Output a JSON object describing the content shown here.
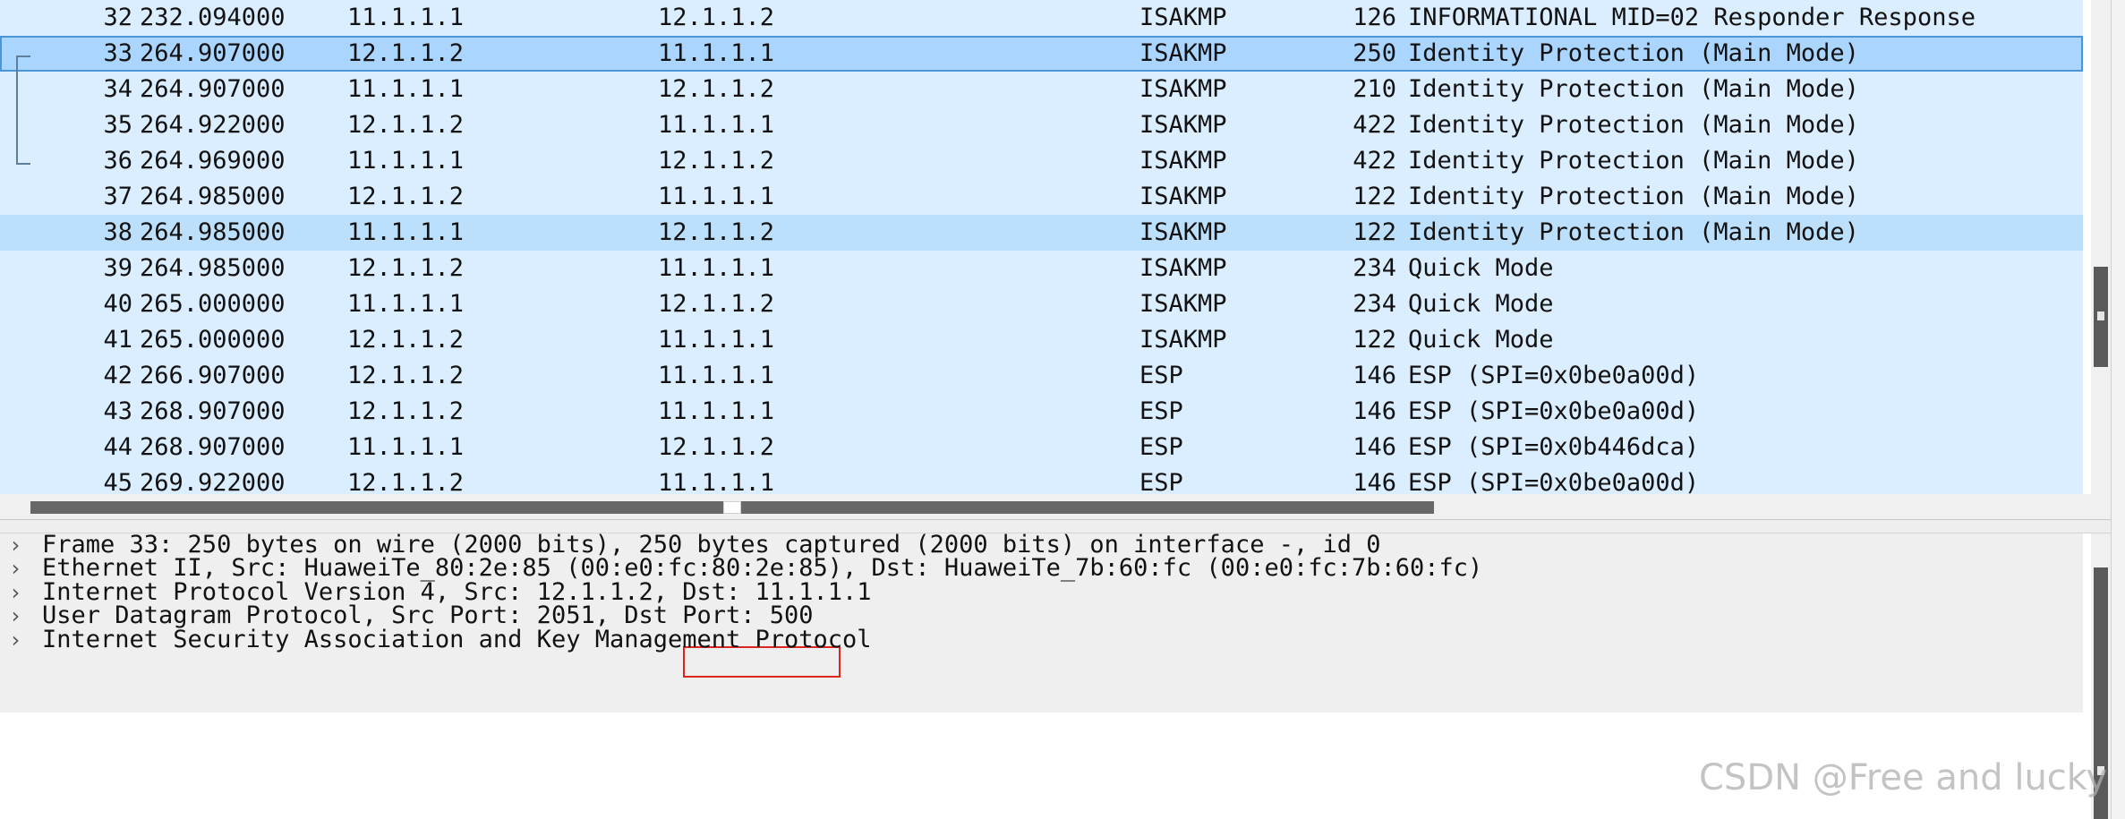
{
  "packets": [
    {
      "no": "32",
      "time": "232.094000",
      "source": "11.1.1.1",
      "destination": "12.1.1.2",
      "protocol": "ISAKMP",
      "length": "126",
      "info": "INFORMATIONAL MID=02 Responder Response",
      "state": "normal"
    },
    {
      "no": "33",
      "time": "264.907000",
      "source": "12.1.1.2",
      "destination": "11.1.1.1",
      "protocol": "ISAKMP",
      "length": "250",
      "info": "Identity Protection (Main Mode)",
      "state": "selected"
    },
    {
      "no": "34",
      "time": "264.907000",
      "source": "11.1.1.1",
      "destination": "12.1.1.2",
      "protocol": "ISAKMP",
      "length": "210",
      "info": "Identity Protection (Main Mode)",
      "state": "normal"
    },
    {
      "no": "35",
      "time": "264.922000",
      "source": "12.1.1.2",
      "destination": "11.1.1.1",
      "protocol": "ISAKMP",
      "length": "422",
      "info": "Identity Protection (Main Mode)",
      "state": "normal"
    },
    {
      "no": "36",
      "time": "264.969000",
      "source": "11.1.1.1",
      "destination": "12.1.1.2",
      "protocol": "ISAKMP",
      "length": "422",
      "info": "Identity Protection (Main Mode)",
      "state": "normal"
    },
    {
      "no": "37",
      "time": "264.985000",
      "source": "12.1.1.2",
      "destination": "11.1.1.1",
      "protocol": "ISAKMP",
      "length": "122",
      "info": "Identity Protection (Main Mode)",
      "state": "normal"
    },
    {
      "no": "38",
      "time": "264.985000",
      "source": "11.1.1.1",
      "destination": "12.1.1.2",
      "protocol": "ISAKMP",
      "length": "122",
      "info": "Identity Protection (Main Mode)",
      "state": "hover"
    },
    {
      "no": "39",
      "time": "264.985000",
      "source": "12.1.1.2",
      "destination": "11.1.1.1",
      "protocol": "ISAKMP",
      "length": "234",
      "info": "Quick Mode",
      "state": "normal"
    },
    {
      "no": "40",
      "time": "265.000000",
      "source": "11.1.1.1",
      "destination": "12.1.1.2",
      "protocol": "ISAKMP",
      "length": "234",
      "info": "Quick Mode",
      "state": "normal"
    },
    {
      "no": "41",
      "time": "265.000000",
      "source": "12.1.1.2",
      "destination": "11.1.1.1",
      "protocol": "ISAKMP",
      "length": "122",
      "info": "Quick Mode",
      "state": "normal"
    },
    {
      "no": "42",
      "time": "266.907000",
      "source": "12.1.1.2",
      "destination": "11.1.1.1",
      "protocol": "ESP",
      "length": "146",
      "info": "ESP (SPI=0x0be0a00d)",
      "state": "normal"
    },
    {
      "no": "43",
      "time": "268.907000",
      "source": "12.1.1.2",
      "destination": "11.1.1.1",
      "protocol": "ESP",
      "length": "146",
      "info": "ESP (SPI=0x0be0a00d)",
      "state": "normal"
    },
    {
      "no": "44",
      "time": "268.907000",
      "source": "11.1.1.1",
      "destination": "12.1.1.2",
      "protocol": "ESP",
      "length": "146",
      "info": "ESP (SPI=0x0b446dca)",
      "state": "normal"
    },
    {
      "no": "45",
      "time": "269.922000",
      "source": "12.1.1.2",
      "destination": "11.1.1.1",
      "protocol": "ESP",
      "length": "146",
      "info": "ESP (SPI=0x0be0a00d)",
      "state": "normal"
    }
  ],
  "details": [
    {
      "chevron": "›",
      "text": "Frame 33: 250 bytes on wire (2000 bits), 250 bytes captured (2000 bits) on interface -, id 0"
    },
    {
      "chevron": "›",
      "text": "Ethernet II, Src: HuaweiTe_80:2e:85 (00:e0:fc:80:2e:85), Dst: HuaweiTe_7b:60:fc (00:e0:fc:7b:60:fc)"
    },
    {
      "chevron": "›",
      "text": "Internet Protocol Version 4, Src: 12.1.1.2, Dst: 11.1.1.1"
    },
    {
      "chevron": "›",
      "text": "User Datagram Protocol, Src Port: 2051, Dst Port: 500"
    },
    {
      "chevron": "›",
      "text": "Internet Security Association and Key Management Protocol"
    }
  ],
  "watermark": "CSDN @Free and lucky",
  "colors": {
    "row_bg": "#dbeeff",
    "selected_bg": "#a9d5ff",
    "hover_bg": "#bcdffb",
    "highlight_border": "#e0261c"
  },
  "icons": {
    "expand": "chevron-right-icon"
  }
}
